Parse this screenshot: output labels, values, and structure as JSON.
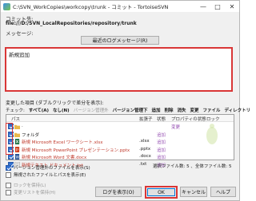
{
  "window": {
    "title": "C:\\SVN_WorkCopies\\workcopy\\trunk - コミット - TortoiseSVN",
    "min_label": "—",
    "max_label": "□",
    "close_label": "✕"
  },
  "commit_target": {
    "label": "コミット先:",
    "url": "file:///D:/SVN_LocalRepositories/repository/trunk"
  },
  "message": {
    "label": "メッセージ:",
    "recent_button": "最近のログメッセージ(R)",
    "text": "新規追加"
  },
  "changes": {
    "label": "変更した項目 (ダブルクリックで差分を表示):",
    "filter_label": "チェック:",
    "filters": [
      {
        "text": "すべて(A)",
        "enabled": true
      },
      {
        "text": "なし(N)",
        "enabled": true
      },
      {
        "text": "バージョン管理外",
        "enabled": false
      },
      {
        "text": "バージョン管理下",
        "enabled": true
      },
      {
        "text": "追加",
        "enabled": true
      },
      {
        "text": "削除",
        "enabled": true
      },
      {
        "text": "消失",
        "enabled": true
      },
      {
        "text": "変更",
        "enabled": true
      },
      {
        "text": "ファイル",
        "enabled": true
      },
      {
        "text": "ディレクトリ",
        "enabled": true
      }
    ],
    "columns": {
      "path": "パス",
      "ext": "拡張子",
      "status": "状態",
      "prop_status": "プロパティの状態",
      "lock": "ロック"
    },
    "rows": [
      {
        "name": ".",
        "icon": "folder-icon",
        "ext": "",
        "status": "",
        "prop_status": "変更"
      },
      {
        "name": "フォルダ",
        "icon": "folder-icon",
        "ext": "",
        "status": "追加",
        "prop_status": ""
      },
      {
        "name": "新規 Microsoft Excel ワークシート.xlsx",
        "icon": "excel-file-icon",
        "ext": ".xlsx",
        "status": "追加",
        "prop_status": ""
      },
      {
        "name": "新規 Microsoft PowerPoint プレゼンテーション.pptx",
        "icon": "powerpoint-file-icon",
        "ext": ".pptx",
        "status": "追加",
        "prop_status": ""
      },
      {
        "name": "新規 Microsoft Word 文書.docx",
        "icon": "word-file-icon",
        "ext": ".docx",
        "status": "追加",
        "prop_status": ""
      },
      {
        "name": "新規テキスト ドキュメント.txt",
        "icon": "text-file-icon",
        "ext": ".txt",
        "status": "追加",
        "prop_status": ""
      }
    ],
    "summary": "選択ファイル数: 5 、全体ファイル数: 5"
  },
  "options": {
    "show_unversioned": "バージョン管理外のファイルを表示(S)",
    "show_externals": "無視されたファイルとパスを表示(E)",
    "keep_locks": "ロックを保持(L)",
    "keep_changelists": "変更リストを保持(H)"
  },
  "buttons": {
    "show_log": "ログを表示(O)",
    "ok": "OK",
    "cancel": "キャンセル",
    "help": "ヘルプ"
  },
  "colors": {
    "highlight": "#d93636",
    "checkbox": "#2f6fd0",
    "added_status": "#9b59b6"
  }
}
